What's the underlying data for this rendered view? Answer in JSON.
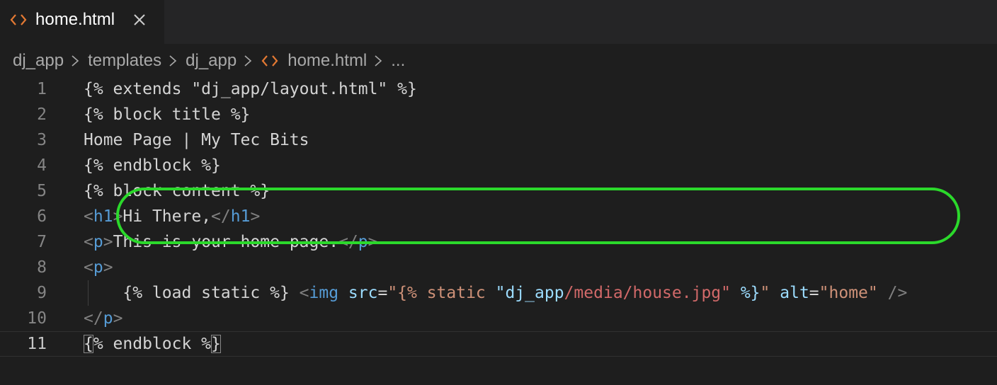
{
  "tab": {
    "filename": "home.html",
    "icon": "html-file-icon",
    "icon_color": "#e37933"
  },
  "breadcrumb": {
    "items": [
      "dj_app",
      "templates",
      "dj_app",
      "home.html",
      "..."
    ]
  },
  "editor": {
    "current_line": 11,
    "lines": [
      {
        "n": "1",
        "t": [
          {
            "c": "{% extends \"dj_app/layout.html\" %}",
            "k": "plain"
          }
        ]
      },
      {
        "n": "2",
        "t": [
          {
            "c": "{% block title %}",
            "k": "plain"
          }
        ]
      },
      {
        "n": "3",
        "t": [
          {
            "c": "Home Page | My Tec Bits",
            "k": "plain"
          }
        ]
      },
      {
        "n": "4",
        "t": [
          {
            "c": "{% endblock %}",
            "k": "plain"
          }
        ]
      },
      {
        "n": "5",
        "t": [
          {
            "c": "{% block content %}",
            "k": "plain"
          }
        ]
      },
      {
        "n": "6",
        "t": [
          {
            "c": "<",
            "k": "punct"
          },
          {
            "c": "h1",
            "k": "tag"
          },
          {
            "c": ">",
            "k": "punct"
          },
          {
            "c": "Hi There,",
            "k": "plain"
          },
          {
            "c": "</",
            "k": "punct"
          },
          {
            "c": "h1",
            "k": "tag"
          },
          {
            "c": ">",
            "k": "punct"
          }
        ]
      },
      {
        "n": "7",
        "t": [
          {
            "c": "<",
            "k": "punct"
          },
          {
            "c": "p",
            "k": "tag"
          },
          {
            "c": ">",
            "k": "punct"
          },
          {
            "c": "This is your home page.",
            "k": "plain"
          },
          {
            "c": "</",
            "k": "punct"
          },
          {
            "c": "p",
            "k": "tag"
          },
          {
            "c": ">",
            "k": "punct"
          }
        ]
      },
      {
        "n": "8",
        "t": [
          {
            "c": "<",
            "k": "punct"
          },
          {
            "c": "p",
            "k": "tag"
          },
          {
            "c": ">",
            "k": "punct"
          }
        ]
      },
      {
        "n": "9",
        "indent": true,
        "t": [
          {
            "c": "    {% load static %} ",
            "k": "plain"
          },
          {
            "c": "<",
            "k": "punct"
          },
          {
            "c": "img",
            "k": "tag"
          },
          {
            "c": " ",
            "k": "plain"
          },
          {
            "c": "src",
            "k": "attr"
          },
          {
            "c": "=",
            "k": "plain"
          },
          {
            "c": "\"{% static ",
            "k": "str"
          },
          {
            "c": "\"dj_app",
            "k": "attr"
          },
          {
            "c": "/media/house.jpg\"",
            "k": "strpath"
          },
          {
            "c": " %}",
            "k": "attr"
          },
          {
            "c": "\"",
            "k": "str"
          },
          {
            "c": " ",
            "k": "plain"
          },
          {
            "c": "alt",
            "k": "attr"
          },
          {
            "c": "=",
            "k": "plain"
          },
          {
            "c": "\"home\"",
            "k": "str"
          },
          {
            "c": " ",
            "k": "plain"
          },
          {
            "c": "/>",
            "k": "punct"
          }
        ]
      },
      {
        "n": "10",
        "t": [
          {
            "c": "</",
            "k": "punct"
          },
          {
            "c": "p",
            "k": "tag"
          },
          {
            "c": ">",
            "k": "punct"
          }
        ]
      },
      {
        "n": "11",
        "t": [
          {
            "c": "{",
            "k": "match"
          },
          {
            "c": "% endblock %",
            "k": "plain"
          },
          {
            "c": "}",
            "k": "match"
          }
        ]
      }
    ]
  },
  "annotation": {
    "ring_color": "#2bd92b",
    "highlighted_line": 9
  }
}
